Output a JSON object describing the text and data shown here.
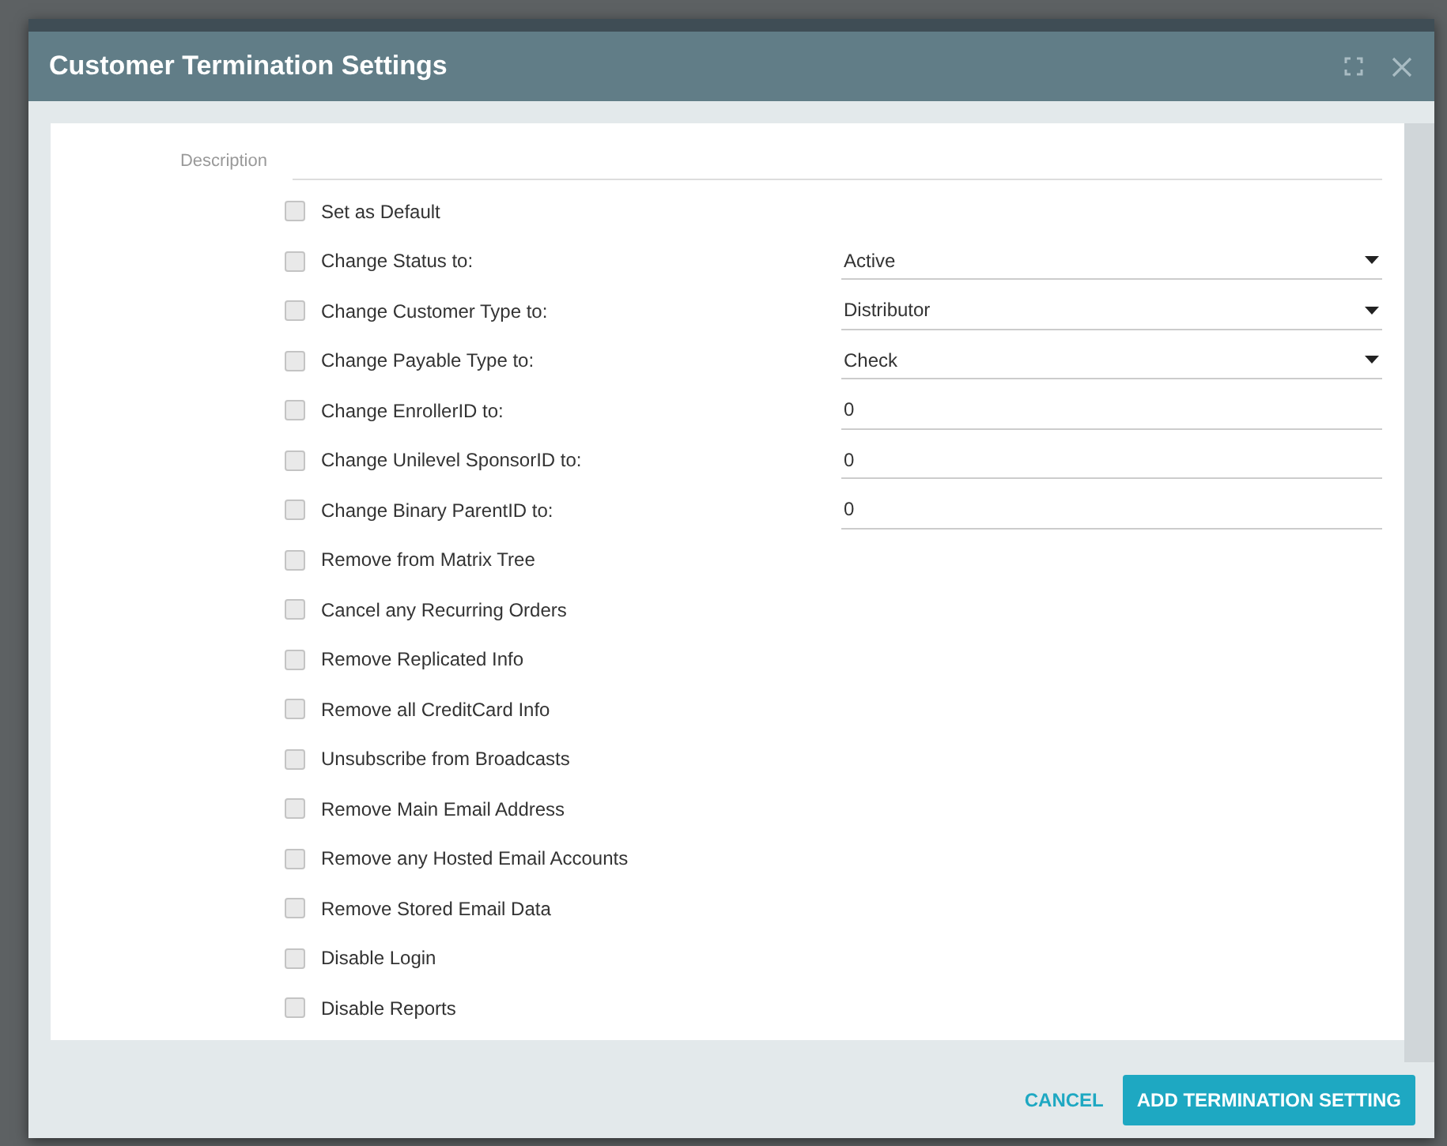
{
  "dialog": {
    "title": "Customer Termination Settings"
  },
  "description": {
    "label": "Description"
  },
  "options": [
    {
      "kind": "checkbox",
      "label": "Set as Default",
      "checked": false
    },
    {
      "kind": "select",
      "label": "Change Status to:",
      "checked": false,
      "value": "Active"
    },
    {
      "kind": "select",
      "label": "Change Customer Type to:",
      "checked": false,
      "value": "Distributor"
    },
    {
      "kind": "select",
      "label": "Change Payable Type to:",
      "checked": false,
      "value": "Check"
    },
    {
      "kind": "input",
      "label": "Change EnrollerID to:",
      "checked": false,
      "value": "0"
    },
    {
      "kind": "input",
      "label": "Change Unilevel SponsorID to:",
      "checked": false,
      "value": "0"
    },
    {
      "kind": "input",
      "label": "Change Binary ParentID to:",
      "checked": false,
      "value": "0"
    },
    {
      "kind": "checkbox",
      "label": "Remove from Matrix Tree",
      "checked": false
    },
    {
      "kind": "checkbox",
      "label": "Cancel any Recurring Orders",
      "checked": false
    },
    {
      "kind": "checkbox",
      "label": "Remove Replicated Info",
      "checked": false
    },
    {
      "kind": "checkbox",
      "label": "Remove all CreditCard Info",
      "checked": false
    },
    {
      "kind": "checkbox",
      "label": "Unsubscribe from Broadcasts",
      "checked": false
    },
    {
      "kind": "checkbox",
      "label": "Remove Main Email Address",
      "checked": false
    },
    {
      "kind": "checkbox",
      "label": "Remove any Hosted Email Accounts",
      "checked": false
    },
    {
      "kind": "checkbox",
      "label": "Remove Stored Email Data",
      "checked": false
    },
    {
      "kind": "checkbox",
      "label": "Disable Login",
      "checked": false
    },
    {
      "kind": "checkbox",
      "label": "Disable Reports",
      "checked": false
    }
  ],
  "buttons": {
    "cancel": "CANCEL",
    "submit": "ADD TERMINATION SETTING"
  }
}
